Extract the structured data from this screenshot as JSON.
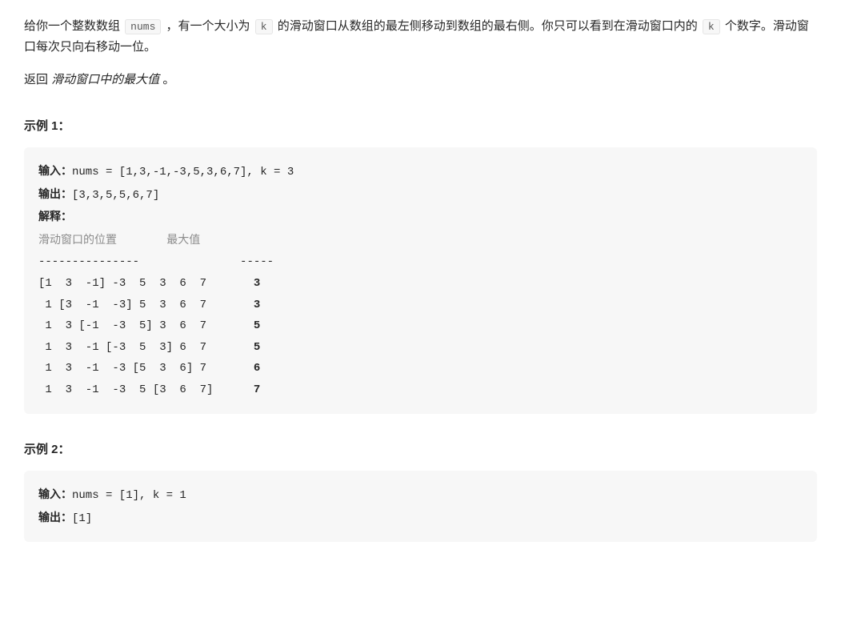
{
  "description": {
    "para1_prefix": "给你一个整数数组 ",
    "code_nums": "nums",
    "para1_mid1": " ，有一个大小为 ",
    "code_k": "k",
    "para1_mid2": " 的滑动窗口从数组的最左侧移动到数组的最右侧。你只可以看到在滑动窗口内的 ",
    "para1_mid3": " 个数字。滑动窗口每次只向右移动一位。",
    "para2_prefix": "返回 ",
    "para2_italic": "滑动窗口中的最大值",
    "para2_suffix": " 。"
  },
  "example1": {
    "heading": "示例 1：",
    "input_label": "输入：",
    "input_value": "nums = [1,3,-1,-3,5,3,6,7], k = 3",
    "output_label": "输出：",
    "output_value": "[3,3,5,5,6,7]",
    "explain_label": "解释：",
    "table_header": "滑动窗口的位置                最大值",
    "table_divider": "---------------               -----",
    "row1_window": "[1  3  -1] -3  5  3  6  7       ",
    "row1_max": "3",
    "row2_window": " 1 [3  -1  -3] 5  3  6  7       ",
    "row2_max": "3",
    "row3_window": " 1  3 [-1  -3  5] 3  6  7       ",
    "row3_max": "5",
    "row4_window": " 1  3  -1 [-3  5  3] 6  7       ",
    "row4_max": "5",
    "row5_window": " 1  3  -1  -3 [5  3  6] 7       ",
    "row5_max": "6",
    "row6_window": " 1  3  -1  -3  5 [3  6  7]      ",
    "row6_max": "7"
  },
  "example2": {
    "heading": "示例 2：",
    "input_label": "输入：",
    "input_value": "nums = [1], k = 1",
    "output_label": "输出：",
    "output_value": "[1]"
  }
}
